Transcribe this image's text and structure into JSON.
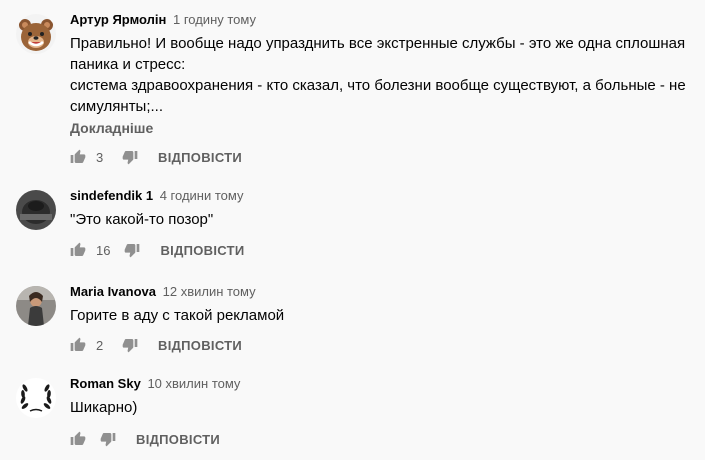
{
  "comments": [
    {
      "author": "Артур Ярмолін",
      "time": "1 годину тому",
      "text_lines": [
        "Правильно! И вообще надо упразднить все экстренные службы - это же одна сплошная",
        "паника и стресс:",
        "система здравоохранения - кто сказал, что болезни вообще существуют, а больные - не",
        "симулянты;..."
      ],
      "more_label": "Докладніше",
      "likes": "3",
      "reply_label": "ВІДПОВІСТИ",
      "avatar": "bear-avatar"
    },
    {
      "author": "sindefendik 1",
      "time": "4 години тому",
      "text_lines": [
        "\"Это какой-то позор\""
      ],
      "likes": "16",
      "reply_label": "ВІДПОВІСТИ",
      "avatar": "dark-photo-avatar"
    },
    {
      "author": "Maria Ivanova",
      "time": "12 хвилин тому",
      "text_lines": [
        "Горите в аду с такой рекламой"
      ],
      "likes": "2",
      "reply_label": "ВІДПОВІСТИ",
      "avatar": "photo-avatar"
    },
    {
      "author": "Roman Sky",
      "time": "10 хвилин тому",
      "text_lines": [
        "Шикарно)"
      ],
      "likes": "",
      "reply_label": "ВІДПОВІСТИ",
      "avatar": "laurel-avatar"
    }
  ],
  "icons": {
    "like": "thumb-up-icon",
    "dislike": "thumb-down-icon"
  },
  "colors": {
    "background": "#f9f9f9",
    "text": "#030303",
    "secondary": "#606060"
  }
}
